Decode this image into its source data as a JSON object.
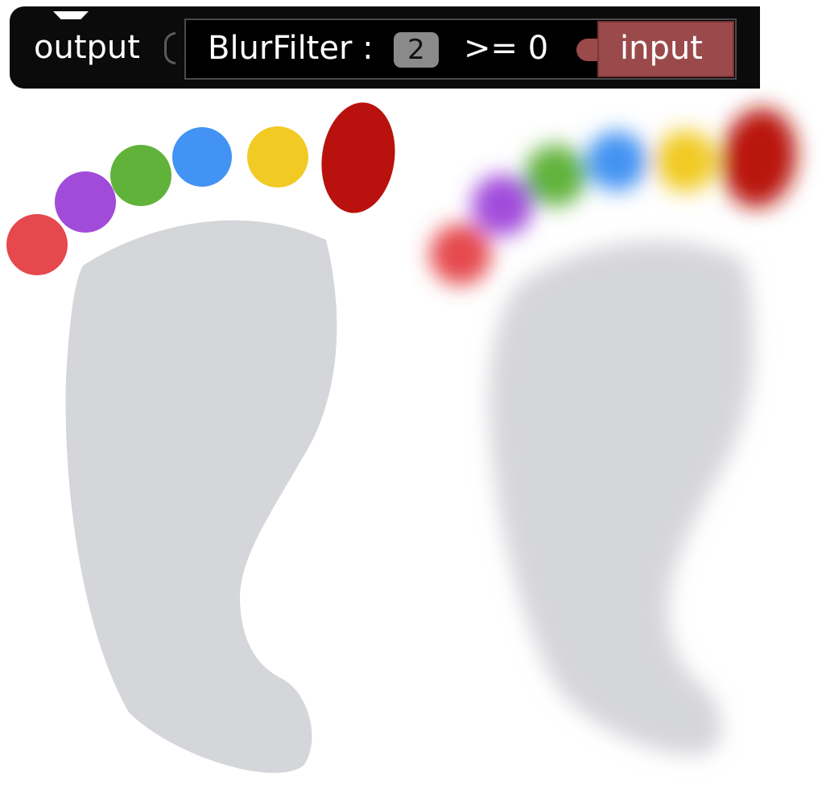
{
  "block": {
    "output_label": "output",
    "filter_name": "BlurFilter :",
    "blur_value": "2",
    "constraint": ">= 0",
    "input_label": "input"
  },
  "images": {
    "original": {
      "subject": "footprint",
      "toe_colors": [
        "#e5484d",
        "#a14bdb",
        "#60b23a",
        "#4293f3",
        "#f1ca24",
        "#b9120e"
      ],
      "sole_color": "#d5d6da"
    },
    "blurred": {
      "subject": "footprint-blurred",
      "toe_colors": [
        "#e5484d",
        "#a14bdb",
        "#60b23a",
        "#4293f3",
        "#f1ca24",
        "#b9120e"
      ],
      "sole_color": "#d5d6da"
    }
  }
}
